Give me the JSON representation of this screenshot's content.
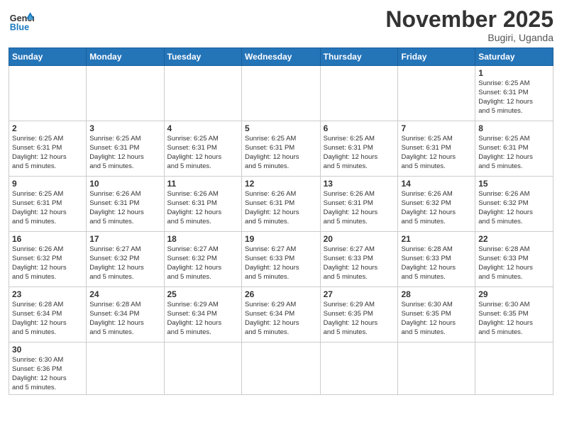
{
  "header": {
    "logo_general": "General",
    "logo_blue": "Blue",
    "month": "November 2025",
    "location": "Bugiri, Uganda"
  },
  "weekdays": [
    "Sunday",
    "Monday",
    "Tuesday",
    "Wednesday",
    "Thursday",
    "Friday",
    "Saturday"
  ],
  "weeks": [
    [
      {
        "day": "",
        "info": ""
      },
      {
        "day": "",
        "info": ""
      },
      {
        "day": "",
        "info": ""
      },
      {
        "day": "",
        "info": ""
      },
      {
        "day": "",
        "info": ""
      },
      {
        "day": "",
        "info": ""
      },
      {
        "day": "1",
        "info": "Sunrise: 6:25 AM\nSunset: 6:31 PM\nDaylight: 12 hours\nand 5 minutes."
      }
    ],
    [
      {
        "day": "2",
        "info": "Sunrise: 6:25 AM\nSunset: 6:31 PM\nDaylight: 12 hours\nand 5 minutes."
      },
      {
        "day": "3",
        "info": "Sunrise: 6:25 AM\nSunset: 6:31 PM\nDaylight: 12 hours\nand 5 minutes."
      },
      {
        "day": "4",
        "info": "Sunrise: 6:25 AM\nSunset: 6:31 PM\nDaylight: 12 hours\nand 5 minutes."
      },
      {
        "day": "5",
        "info": "Sunrise: 6:25 AM\nSunset: 6:31 PM\nDaylight: 12 hours\nand 5 minutes."
      },
      {
        "day": "6",
        "info": "Sunrise: 6:25 AM\nSunset: 6:31 PM\nDaylight: 12 hours\nand 5 minutes."
      },
      {
        "day": "7",
        "info": "Sunrise: 6:25 AM\nSunset: 6:31 PM\nDaylight: 12 hours\nand 5 minutes."
      },
      {
        "day": "8",
        "info": "Sunrise: 6:25 AM\nSunset: 6:31 PM\nDaylight: 12 hours\nand 5 minutes."
      }
    ],
    [
      {
        "day": "9",
        "info": "Sunrise: 6:25 AM\nSunset: 6:31 PM\nDaylight: 12 hours\nand 5 minutes."
      },
      {
        "day": "10",
        "info": "Sunrise: 6:26 AM\nSunset: 6:31 PM\nDaylight: 12 hours\nand 5 minutes."
      },
      {
        "day": "11",
        "info": "Sunrise: 6:26 AM\nSunset: 6:31 PM\nDaylight: 12 hours\nand 5 minutes."
      },
      {
        "day": "12",
        "info": "Sunrise: 6:26 AM\nSunset: 6:31 PM\nDaylight: 12 hours\nand 5 minutes."
      },
      {
        "day": "13",
        "info": "Sunrise: 6:26 AM\nSunset: 6:31 PM\nDaylight: 12 hours\nand 5 minutes."
      },
      {
        "day": "14",
        "info": "Sunrise: 6:26 AM\nSunset: 6:32 PM\nDaylight: 12 hours\nand 5 minutes."
      },
      {
        "day": "15",
        "info": "Sunrise: 6:26 AM\nSunset: 6:32 PM\nDaylight: 12 hours\nand 5 minutes."
      }
    ],
    [
      {
        "day": "16",
        "info": "Sunrise: 6:26 AM\nSunset: 6:32 PM\nDaylight: 12 hours\nand 5 minutes."
      },
      {
        "day": "17",
        "info": "Sunrise: 6:27 AM\nSunset: 6:32 PM\nDaylight: 12 hours\nand 5 minutes."
      },
      {
        "day": "18",
        "info": "Sunrise: 6:27 AM\nSunset: 6:32 PM\nDaylight: 12 hours\nand 5 minutes."
      },
      {
        "day": "19",
        "info": "Sunrise: 6:27 AM\nSunset: 6:33 PM\nDaylight: 12 hours\nand 5 minutes."
      },
      {
        "day": "20",
        "info": "Sunrise: 6:27 AM\nSunset: 6:33 PM\nDaylight: 12 hours\nand 5 minutes."
      },
      {
        "day": "21",
        "info": "Sunrise: 6:28 AM\nSunset: 6:33 PM\nDaylight: 12 hours\nand 5 minutes."
      },
      {
        "day": "22",
        "info": "Sunrise: 6:28 AM\nSunset: 6:33 PM\nDaylight: 12 hours\nand 5 minutes."
      }
    ],
    [
      {
        "day": "23",
        "info": "Sunrise: 6:28 AM\nSunset: 6:34 PM\nDaylight: 12 hours\nand 5 minutes."
      },
      {
        "day": "24",
        "info": "Sunrise: 6:28 AM\nSunset: 6:34 PM\nDaylight: 12 hours\nand 5 minutes."
      },
      {
        "day": "25",
        "info": "Sunrise: 6:29 AM\nSunset: 6:34 PM\nDaylight: 12 hours\nand 5 minutes."
      },
      {
        "day": "26",
        "info": "Sunrise: 6:29 AM\nSunset: 6:34 PM\nDaylight: 12 hours\nand 5 minutes."
      },
      {
        "day": "27",
        "info": "Sunrise: 6:29 AM\nSunset: 6:35 PM\nDaylight: 12 hours\nand 5 minutes."
      },
      {
        "day": "28",
        "info": "Sunrise: 6:30 AM\nSunset: 6:35 PM\nDaylight: 12 hours\nand 5 minutes."
      },
      {
        "day": "29",
        "info": "Sunrise: 6:30 AM\nSunset: 6:35 PM\nDaylight: 12 hours\nand 5 minutes."
      }
    ],
    [
      {
        "day": "30",
        "info": "Sunrise: 6:30 AM\nSunset: 6:36 PM\nDaylight: 12 hours\nand 5 minutes."
      },
      {
        "day": "",
        "info": ""
      },
      {
        "day": "",
        "info": ""
      },
      {
        "day": "",
        "info": ""
      },
      {
        "day": "",
        "info": ""
      },
      {
        "day": "",
        "info": ""
      },
      {
        "day": "",
        "info": ""
      }
    ]
  ]
}
